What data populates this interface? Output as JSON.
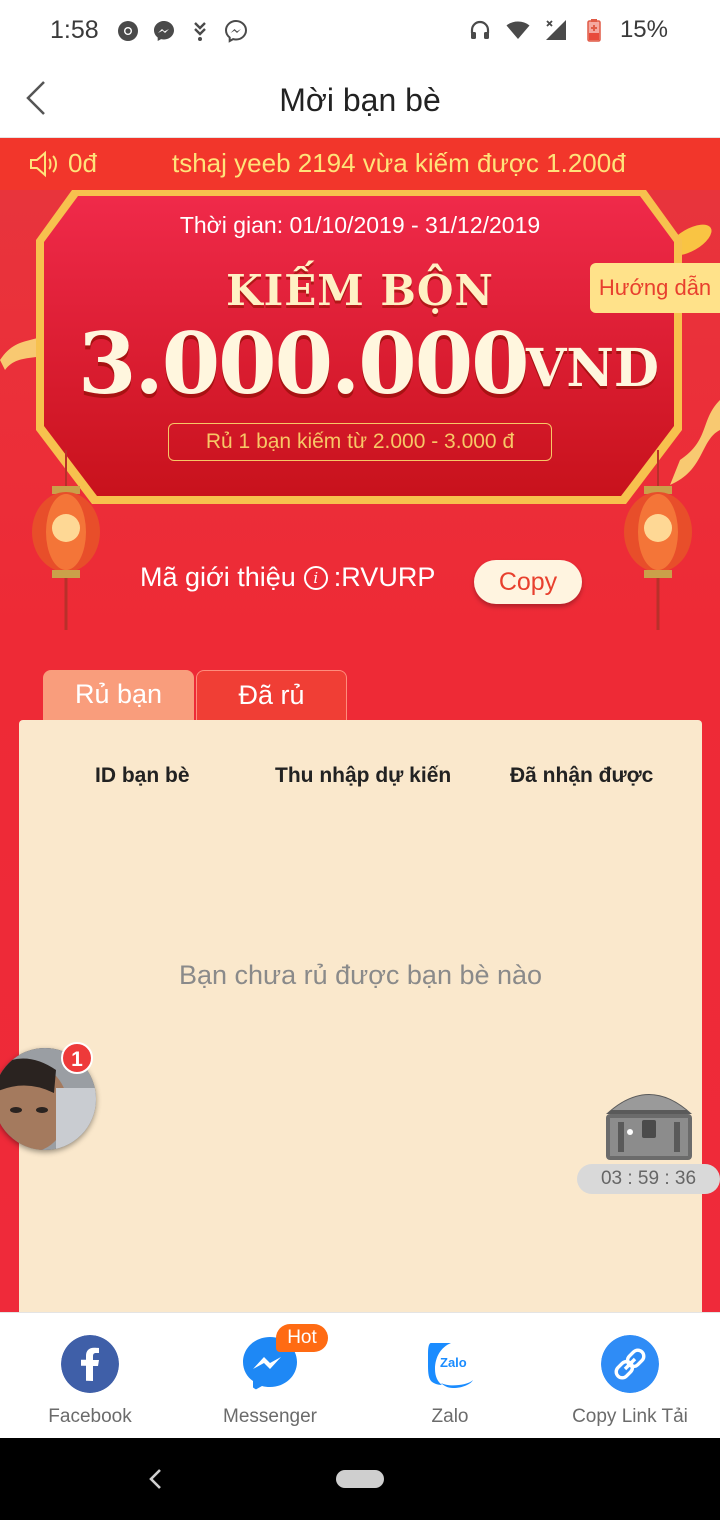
{
  "status_bar": {
    "time": "1:58",
    "battery": "15%",
    "icons": [
      "chrome-icon",
      "messenger-icon",
      "download-icon",
      "messenger-icon",
      "headphones-icon",
      "wifi-icon",
      "signal-icon",
      "battery-icon"
    ]
  },
  "header": {
    "title": "Mời bạn bè"
  },
  "ticker": {
    "balance": "0đ",
    "message": "tshaj yeeb 2194 vừa kiếm được 1.200đ"
  },
  "promo": {
    "period": "Thời gian: 01/10/2019 - 31/12/2019",
    "headline": "KIẾM BỘN",
    "amount": "3.000.000",
    "currency": "VND",
    "note": "Rủ 1 bạn kiếm từ 2.000 - 3.000 đ",
    "guide_label": "Hướng dẫn"
  },
  "referral": {
    "label": "Mã giới thiệu",
    "code_prefix": ": ",
    "code": "RVURP",
    "copy_label": "Copy"
  },
  "tabs": [
    {
      "label": "Rủ bạn",
      "active": true
    },
    {
      "label": "Đã rủ",
      "active": false
    }
  ],
  "table": {
    "columns": [
      "ID bạn bè",
      "Thu nhập dự kiến",
      "Đã nhận được"
    ],
    "empty_message": "Bạn chưa rủ được bạn bè nào"
  },
  "floating": {
    "avatar_badge": "1",
    "countdown": "03 : 59 : 36"
  },
  "share": {
    "items": [
      {
        "label": "Facebook",
        "icon": "facebook-icon",
        "color": "#3f5fa8"
      },
      {
        "label": "Messenger",
        "icon": "messenger-icon",
        "color": "#1e88f5"
      },
      {
        "label": "Zalo",
        "icon": "zalo-icon",
        "color": "#1a8cff"
      },
      {
        "label": "Copy Link Tải",
        "icon": "link-icon",
        "color": "#2f8cf6"
      }
    ],
    "hot_label": "Hot"
  },
  "colors": {
    "primary_red": "#ee2a36",
    "ticker_text": "#ffe37a",
    "panel_bg": "#fae8cc",
    "tab_active": "#f99d7c"
  }
}
